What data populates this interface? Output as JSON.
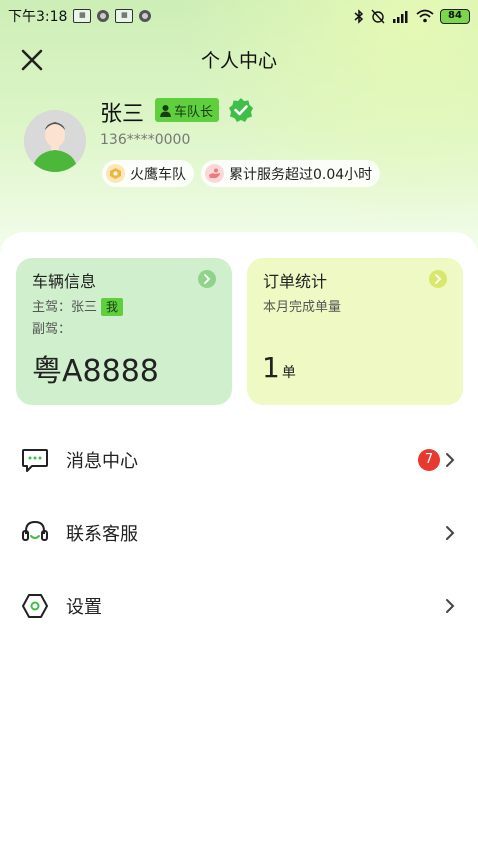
{
  "status_bar": {
    "time": "下午3:18",
    "battery": "84"
  },
  "header": {
    "title": "个人中心"
  },
  "profile": {
    "name": "张三",
    "role_badge": "车队长",
    "phone": "136****0000",
    "fleet_chip": "火鹰车队",
    "service_chip": "累计服务超过0.04小时"
  },
  "vehicle_card": {
    "title": "车辆信息",
    "main_driver": "主驾：张三",
    "me_tag": "我",
    "co_driver": "副驾：",
    "plate": "粤A8888"
  },
  "order_card": {
    "title": "订单统计",
    "subtitle": "本月完成单量",
    "count": "1",
    "unit": "单"
  },
  "menu": {
    "messages": {
      "label": "消息中心",
      "badge": "7"
    },
    "support": {
      "label": "联系客服"
    },
    "settings": {
      "label": "设置"
    }
  },
  "colors": {
    "accent_green": "#5fcf3f",
    "badge_red": "#e8392f",
    "vehicle_card_bg": "#cfefcd",
    "order_card_bg": "#eef9c4"
  }
}
